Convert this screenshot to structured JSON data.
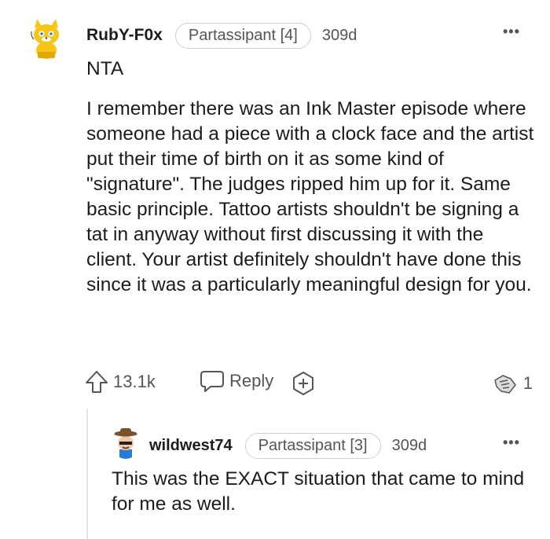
{
  "comments": [
    {
      "username": "RubY-F0x",
      "flair": "Partassipant [4]",
      "timestamp": "309d",
      "more": "•••",
      "body_short": "NTA",
      "body": "I remember there was an Ink Master episode where someone had a piece with a clock face and the artist put their time of birth on it as some kind of \"signature\". The judges ripped him up for it. Same basic principle. Tattoo artists shouldn't be signing a tat in anyway without first discussing it with the client. Your artist definitely shouldn't have done this since it was a particularly meaningful design for you.",
      "upvotes": "13.1k",
      "reply_label": "Reply",
      "awards_count": "1",
      "avatar": "yellow-cat-snoo-avatar"
    },
    {
      "username": "wildwest74",
      "flair": "Partassipant [3]",
      "timestamp": "309d",
      "more": "•••",
      "body": "This was the EXACT situation that came to mind for me as well.",
      "avatar": "cowboy-snoo-avatar"
    }
  ],
  "icons": {
    "upvote": "upvote-arrow-icon",
    "reply": "speech-bubble-icon",
    "award": "award-plus-icon",
    "awards_received": "hands-award-icon",
    "more": "more-options-icon"
  },
  "colors": {
    "text": "#1c1c1c",
    "meta": "#555555",
    "border": "#d0d0d0",
    "avatar_yellow": "#f5c518",
    "avatar_blue": "#2a7bd6"
  }
}
